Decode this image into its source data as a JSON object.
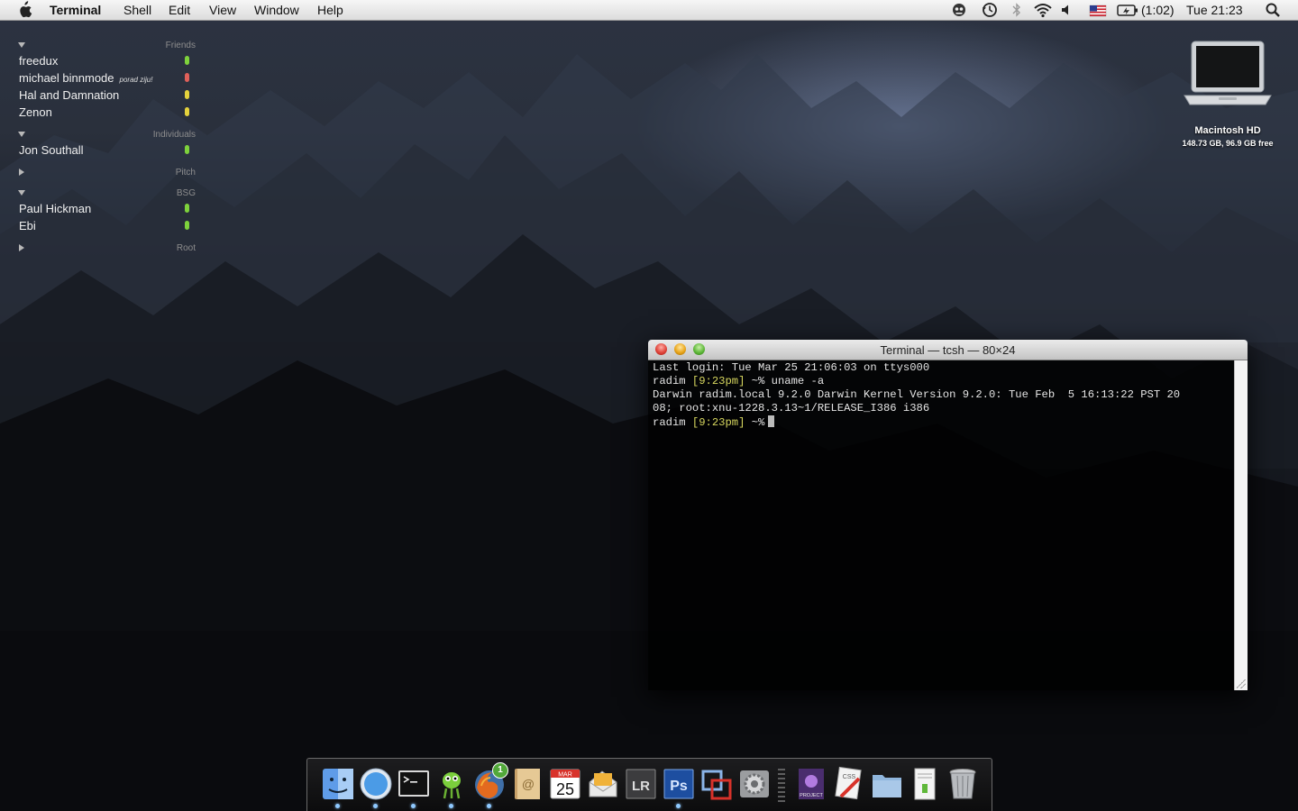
{
  "menubar": {
    "app_name": "Terminal",
    "menus": [
      "Shell",
      "Edit",
      "View",
      "Window",
      "Help"
    ],
    "battery_time": "(1:02)",
    "clock": "Tue 21:23",
    "icons": [
      "apple-icon",
      "robot-icon",
      "time-machine-icon",
      "bluetooth-icon",
      "wifi-icon",
      "volume-icon",
      "us-flag-icon",
      "battery-icon",
      "spotlight-icon"
    ]
  },
  "buddy_list": {
    "groups": [
      {
        "name": "Friends",
        "expanded": true,
        "buddies": [
          {
            "name": "freedux",
            "message": "",
            "status": "green"
          },
          {
            "name": "michael binnmode",
            "message": "porad ziju!",
            "status": "red"
          },
          {
            "name": "Hal and Damnation",
            "message": "",
            "status": "yellow"
          },
          {
            "name": "Zenon",
            "message": "",
            "status": "yellow"
          }
        ]
      },
      {
        "name": "Individuals",
        "expanded": true,
        "buddies": [
          {
            "name": "Jon Southall",
            "message": "",
            "status": "green"
          }
        ]
      },
      {
        "name": "Pitch",
        "expanded": false,
        "buddies": []
      },
      {
        "name": "BSG",
        "expanded": true,
        "buddies": [
          {
            "name": "Paul Hickman",
            "message": "",
            "status": "green"
          },
          {
            "name": "Ebi",
            "message": "",
            "status": "green"
          }
        ]
      },
      {
        "name": "Root",
        "expanded": false,
        "buddies": []
      }
    ],
    "status_colors": {
      "green": "#7ed23c",
      "red": "#e0605a",
      "yellow": "#e4d23c"
    }
  },
  "desktop_drive": {
    "name": "Macintosh HD",
    "info": "148.73 GB, 96.9 GB free"
  },
  "terminal": {
    "title": "Terminal — tcsh — 80×24",
    "lines": [
      {
        "text": "Last login: Tue Mar 25 21:06:03 on ttys000"
      },
      {
        "prompt_user": "radim ",
        "prompt_time": "[9:23pm]",
        "prompt_rest": " ~% uname -a"
      },
      {
        "text": "Darwin radim.local 9.2.0 Darwin Kernel Version 9.2.0: Tue Feb  5 16:13:22 PST 20"
      },
      {
        "text": "08; root:xnu-1228.3.13~1/RELEASE_I386 i386"
      },
      {
        "prompt_user": "radim ",
        "prompt_time": "[9:23pm]",
        "prompt_rest": " ~%"
      }
    ]
  },
  "dock": {
    "calendar_month": "MAR",
    "calendar_day": "25",
    "lightroom_label": "LR",
    "photoshop_label": "Ps",
    "project_label": "PROJECT",
    "css_label": "CSS",
    "badge_count": "1",
    "items": [
      "finder-icon",
      "safari-icon",
      "terminal-app-icon",
      "adium-icon",
      "firefox-icon",
      "address-book-icon",
      "ical-icon",
      "stamps-app-icon",
      "lightroom-icon",
      "photoshop-icon",
      "vmware-icon",
      "system-preferences-icon",
      "project-app-icon",
      "css-edit-icon",
      "applications-folder-icon",
      "documents-stack-icon",
      "trash-icon"
    ]
  }
}
